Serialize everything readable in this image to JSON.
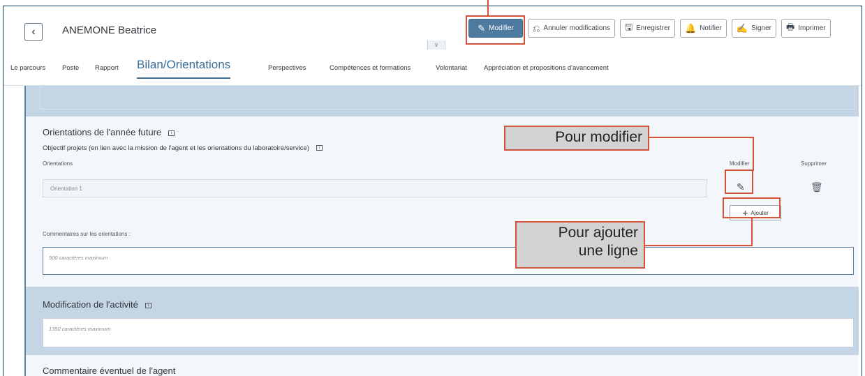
{
  "header": {
    "back_icon": "chevron-left-icon",
    "employee_name": "ANEMONE Beatrice"
  },
  "toolbar": {
    "modifier": "Modifier",
    "annuler": "Annuler modifications",
    "enregistrer": "Enregistrer",
    "notifier": "Notifier",
    "signer": "Signer",
    "imprimer": "Imprimer"
  },
  "tabs": [
    {
      "label": "Le parcours"
    },
    {
      "label": "Poste"
    },
    {
      "label": "Rapport"
    },
    {
      "label": "Bilan/Orientations"
    },
    {
      "label": "Perspectives"
    },
    {
      "label": "Compétences et formations"
    },
    {
      "label": "Volontariat"
    },
    {
      "label": "Appréciation et propositions d'avancement"
    }
  ],
  "orientations": {
    "title": "Orientations de l'année future",
    "objectif": "Objectif projets (en lien avec la mission de l'agent et les orientations du laboratoire/service)",
    "col_orientations": "Orientations",
    "col_modifier": "Modifier",
    "col_supprimer": "Supprimer",
    "row1_placeholder": "Orientation 1",
    "add_label": "Ajouter",
    "comments_label": "Commentaires sur les orientations :",
    "comments_placeholder": "500 caractères maximum"
  },
  "modification": {
    "title": "Modification de l'activité",
    "placeholder": "1350 caractères maximum"
  },
  "commentaire": {
    "title": "Commentaire éventuel de l'agent"
  },
  "annotations": {
    "modify": "Pour modifier",
    "add_line_1": "Pour ajouter",
    "add_line_2": "une ligne"
  },
  "colors": {
    "accent": "#3b6e99",
    "annotation": "#d5533a",
    "band": "#c4d5e6"
  }
}
